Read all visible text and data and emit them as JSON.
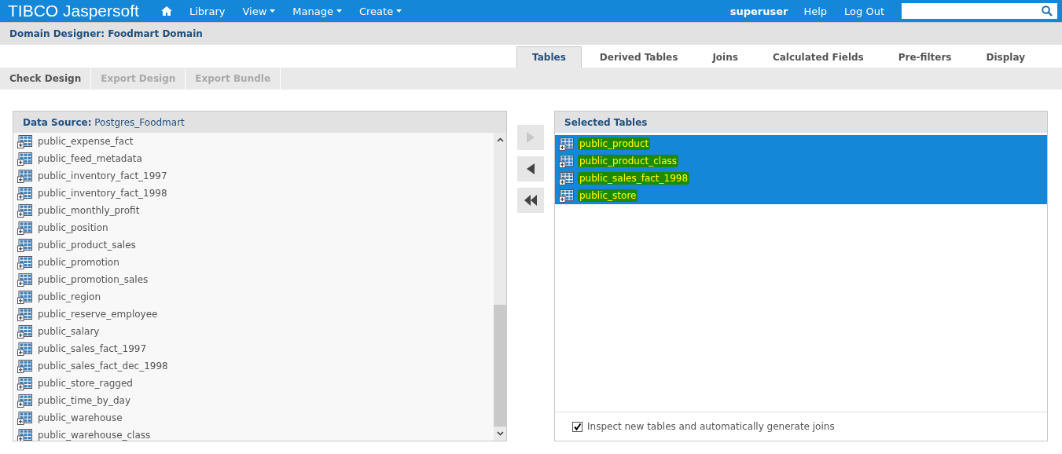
{
  "brand": {
    "name": "TIBCO Jaspersoft"
  },
  "nav": [
    {
      "label": "Library",
      "dropdown": false
    },
    {
      "label": "View",
      "dropdown": true
    },
    {
      "label": "Manage",
      "dropdown": true
    },
    {
      "label": "Create",
      "dropdown": true
    }
  ],
  "user": {
    "name": "superuser",
    "links": [
      "Help",
      "Log Out"
    ]
  },
  "page_title": "Domain Designer: Foodmart Domain",
  "tabs": [
    {
      "label": "Tables",
      "selected": true
    },
    {
      "label": "Derived Tables",
      "selected": false
    },
    {
      "label": "Joins",
      "selected": false
    },
    {
      "label": "Calculated Fields",
      "selected": false
    },
    {
      "label": "Pre-filters",
      "selected": false
    },
    {
      "label": "Display",
      "selected": false
    }
  ],
  "toolbar": [
    {
      "label": "Check Design",
      "disabled": false
    },
    {
      "label": "Export Design",
      "disabled": true
    },
    {
      "label": "Export Bundle",
      "disabled": true
    }
  ],
  "source_panel": {
    "label": "Data Source:",
    "value": "Postgres_Foodmart",
    "items": [
      "public_expense_fact",
      "public_feed_metadata",
      "public_inventory_fact_1997",
      "public_inventory_fact_1998",
      "public_monthly_profit",
      "public_position",
      "public_product_sales",
      "public_promotion",
      "public_promotion_sales",
      "public_region",
      "public_reserve_employee",
      "public_salary",
      "public_sales_fact_1997",
      "public_sales_fact_dec_1998",
      "public_store_ragged",
      "public_time_by_day",
      "public_warehouse",
      "public_warehouse_class"
    ]
  },
  "move_buttons": [
    {
      "kind": "add",
      "disabled": true
    },
    {
      "kind": "remove",
      "disabled": false
    },
    {
      "kind": "remove_all",
      "disabled": false
    }
  ],
  "selected_panel": {
    "title": "Selected Tables",
    "items": [
      {
        "label": "public_product",
        "selected": true
      },
      {
        "label": "public_product_class",
        "selected": true
      },
      {
        "label": "public_sales_fact_1998",
        "selected": true
      },
      {
        "label": "public_store",
        "selected": true
      }
    ],
    "option": {
      "label": "Inspect new tables and automatically generate joins",
      "checked": true
    }
  }
}
